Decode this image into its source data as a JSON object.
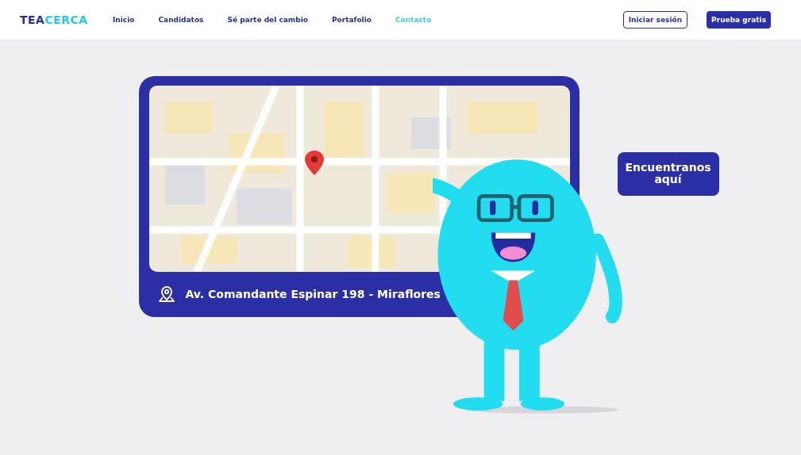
{
  "header": {
    "logo": [
      {
        "text": "TEA",
        "kind": "dark"
      },
      {
        "text": "CERCA",
        "kind": "accent"
      }
    ],
    "nav": [
      {
        "label": "Inicio",
        "selected": false
      },
      {
        "label": "Candidatos",
        "selected": false
      },
      {
        "label": "Sé parte del cambio",
        "selected": false
      },
      {
        "label": "Portafolio",
        "selected": false
      },
      {
        "label": "Contacto",
        "selected": true
      }
    ],
    "login_button": "Iniciar sesión",
    "trial_button": "Prueba gratis"
  },
  "location_card": {
    "address": "Av. Comandante Espinar 198 - Miraflores"
  },
  "speech_bubble": {
    "text": "Encuentranos aquí"
  }
}
